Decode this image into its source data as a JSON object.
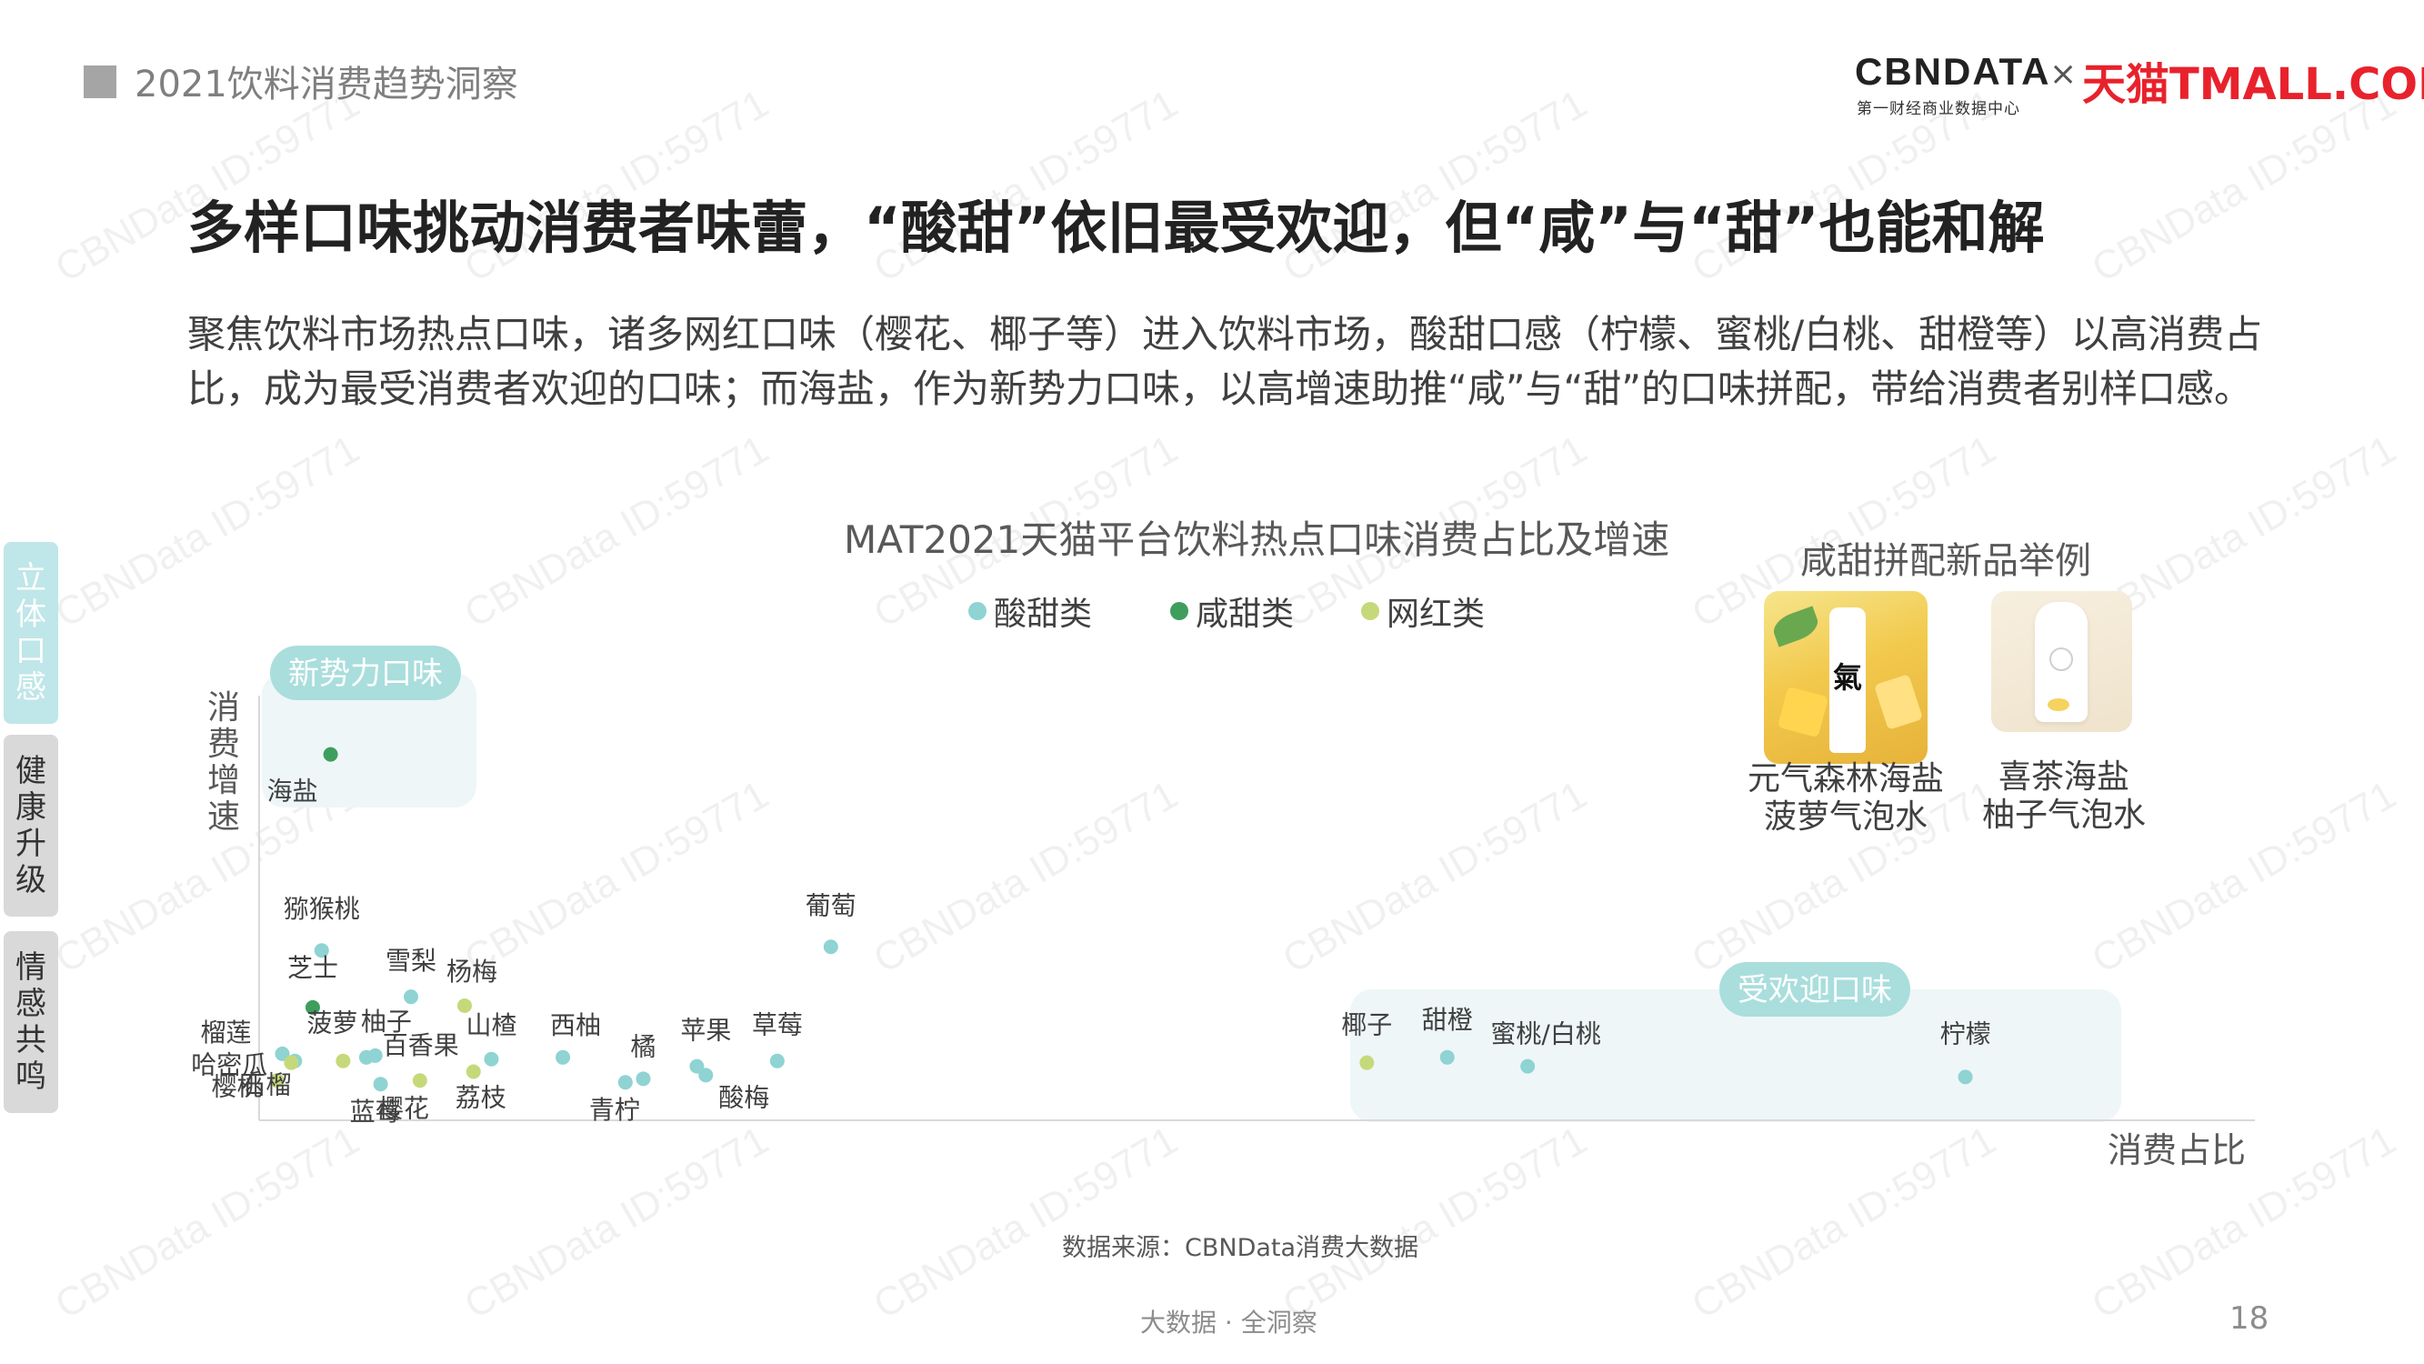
{
  "header": {
    "label": "2021饮料消费趋势洞察",
    "brand": {
      "cbndata": "CBNDATA",
      "cbndata_sub": "第一财经商业数据中心",
      "separator": "×",
      "tmall": "天猫TMALL.COM"
    }
  },
  "watermark": "CBNData ID:59771",
  "headline": "多样口味挑动消费者味蕾，“酸甜”依旧最受欢迎，但“咸”与“甜”也能和解",
  "lede": "聚焦饮料市场热点口味，诸多网红口味（樱花、椰子等）进入饮料市场，酸甜口感（柠檬、蜜桃/白桃、甜橙等）以高消费占比，成为最受消费者欢迎的口味；而海盐，作为新势力口味，以高增速助推“咸”与“甜”的口味拼配，带给消费者别样口感。",
  "side_tabs": [
    {
      "label": "立体口感",
      "active": true
    },
    {
      "label": "健康升级",
      "active": false
    },
    {
      "label": "情感共鸣",
      "active": false
    }
  ],
  "chart_data": {
    "type": "scatter",
    "title": "MAT2021天猫平台饮料热点口味消费占比及增速",
    "xlabel": "消费占比",
    "ylabel": "消费增速",
    "axis_ticks": false,
    "grid": false,
    "legend_position": "top",
    "colors": {
      "酸甜类": "#8fd3d3",
      "咸甜类": "#3f9e5e",
      "网红类": "#c5d97a"
    },
    "series": [
      {
        "name": "酸甜类",
        "points": [
          {
            "label": "猕猴桃",
            "x": 0.035,
            "y": 0.4
          },
          {
            "label": "雪梨",
            "x": 0.085,
            "y": 0.27
          },
          {
            "label": "葡萄",
            "x": 0.32,
            "y": 0.41
          },
          {
            "label": "榴莲",
            "x": 0.013,
            "y": 0.11
          },
          {
            "label": "哈密瓜",
            "x": 0.02,
            "y": 0.09
          },
          {
            "label": "柚子",
            "x": 0.06,
            "y": 0.1
          },
          {
            "label": "百香果",
            "x": 0.065,
            "y": 0.105
          },
          {
            "label": "蓝莓",
            "x": 0.068,
            "y": 0.025
          },
          {
            "label": "山楂",
            "x": 0.13,
            "y": 0.095
          },
          {
            "label": "西柚",
            "x": 0.17,
            "y": 0.1
          },
          {
            "label": "青柠",
            "x": 0.205,
            "y": 0.03
          },
          {
            "label": "橘",
            "x": 0.215,
            "y": 0.04
          },
          {
            "label": "苹果",
            "x": 0.245,
            "y": 0.075
          },
          {
            "label": "酸梅",
            "x": 0.25,
            "y": 0.05
          },
          {
            "label": "草莓",
            "x": 0.29,
            "y": 0.09
          },
          {
            "label": "甜橙",
            "x": 0.665,
            "y": 0.1
          },
          {
            "label": "蜜桃/白桃",
            "x": 0.71,
            "y": 0.075
          },
          {
            "label": "柠檬",
            "x": 0.955,
            "y": 0.045
          }
        ]
      },
      {
        "name": "咸甜类",
        "points": [
          {
            "label": "海盐",
            "x": 0.04,
            "y": 0.95
          },
          {
            "label": "芝士",
            "x": 0.03,
            "y": 0.24
          }
        ]
      },
      {
        "name": "网红类",
        "points": [
          {
            "label": "杨梅",
            "x": 0.115,
            "y": 0.245
          },
          {
            "label": "樱桃",
            "x": 0.01,
            "y": 0.035
          },
          {
            "label": "菠萝",
            "x": 0.047,
            "y": 0.09
          },
          {
            "label": "石榴",
            "x": 0.018,
            "y": 0.085
          },
          {
            "label": "樱花",
            "x": 0.09,
            "y": 0.035
          },
          {
            "label": "荔枝",
            "x": 0.12,
            "y": 0.06
          },
          {
            "label": "椰子",
            "x": 0.62,
            "y": 0.085
          }
        ]
      }
    ],
    "callouts": [
      {
        "label": "新势力口味"
      },
      {
        "label": "受欢迎口味"
      }
    ]
  },
  "examples": {
    "title": "咸甜拼配新品举例",
    "products": [
      {
        "name_line1": "元气森林海盐",
        "name_line2": "菠萝气泡水",
        "icon": "pineapple-sparkling-water-image",
        "label_char": "氣"
      },
      {
        "name_line1": "喜茶海盐",
        "name_line2": "柚子气泡水",
        "icon": "grapefruit-sparkling-water-image"
      }
    ]
  },
  "source_note": "数据来源：CBNData消费大数据",
  "footer_text": "大数据 · 全洞察",
  "page_number": "18"
}
